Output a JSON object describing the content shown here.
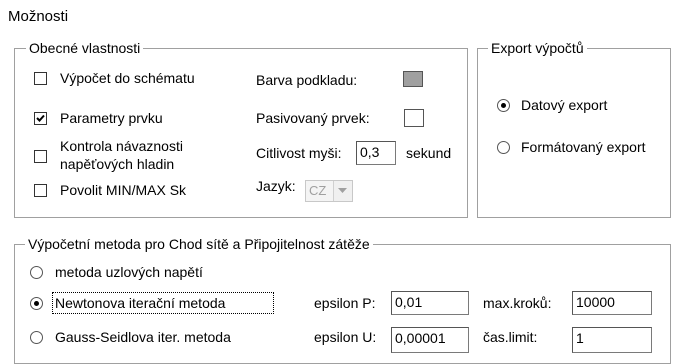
{
  "title": "Možnosti",
  "general": {
    "legend": "Obecné vlastnosti",
    "checks": [
      {
        "label": "Výpočet do schématu",
        "checked": false
      },
      {
        "label": "Parametry prvku",
        "checked": true
      },
      {
        "label_line1": "Kontrola návaznosti",
        "label_line2": "napěťových hladin",
        "checked": false
      },
      {
        "label": "Povolit MIN/MAX Sk",
        "checked": false
      }
    ],
    "bg_color_label": "Barva podkladu:",
    "bg_color": "#a0a0a0",
    "passive_label": "Pasivovaný prvek:",
    "mouse_label": "Citlivost myši:",
    "mouse_value": "0,3",
    "mouse_unit": "sekund",
    "lang_label": "Jazyk:",
    "lang_value": "CZ"
  },
  "export": {
    "legend": "Export výpočtů",
    "options": [
      {
        "label": "Datový export",
        "selected": true
      },
      {
        "label": "Formátovaný export",
        "selected": false
      }
    ]
  },
  "method": {
    "legend": "Výpočetní metoda pro Chod sítě a Připojitelnost zátěže",
    "options": [
      {
        "label": "metoda uzlových napětí",
        "selected": false
      },
      {
        "label": "Newtonova iterační metoda",
        "selected": true
      },
      {
        "label": "Gauss-Seidlova iter. metoda",
        "selected": false
      }
    ],
    "eps_p_label": "epsilon P:",
    "eps_p_value": "0,01",
    "eps_u_label": "epsilon U:",
    "eps_u_value": "0,00001",
    "max_steps_label": "max.kroků:",
    "max_steps_value": "10000",
    "time_limit_label": "čas.limit:",
    "time_limit_value": "1"
  },
  "icons": {
    "check": "check-mark-icon",
    "dropdown": "chevron-down-icon"
  }
}
